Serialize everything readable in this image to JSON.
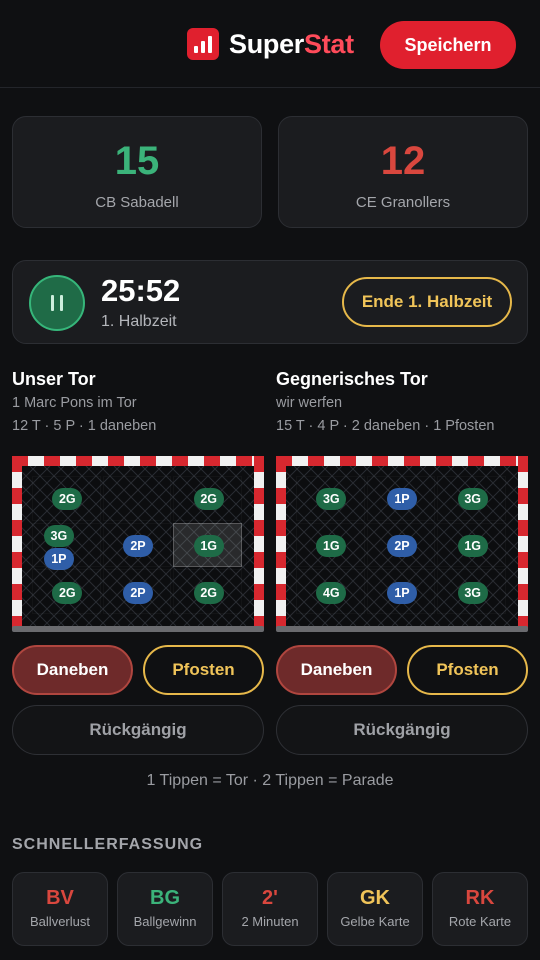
{
  "header": {
    "brand_a": "Super",
    "brand_b": "Stat",
    "save_label": "Speichern"
  },
  "colors": {
    "accent_red": "#e0202e",
    "home_score": "#3bb37a",
    "away_score": "#d9473e",
    "gold": "#f0c459",
    "save_green": "#1e6b47",
    "post_blue": "#2f5ea8"
  },
  "scores": {
    "home": {
      "value": "15",
      "team": "CB Sabadell"
    },
    "away": {
      "value": "12",
      "team": "CE Granollers"
    }
  },
  "timer": {
    "time": "25:52",
    "half": "1. Halbzeit",
    "end_label": "Ende 1. Halbzeit",
    "pause_icon": "pause-icon"
  },
  "our_goal": {
    "title": "Unser Tor",
    "keeper": "1 Marc Pons im Tor",
    "stats": "12 T · 5 P · 1 daneben",
    "cells": [
      {
        "zone": 1,
        "labels": [
          "2G"
        ]
      },
      {
        "zone": 2,
        "labels": []
      },
      {
        "zone": 3,
        "labels": [
          "2G"
        ]
      },
      {
        "zone": 4,
        "labels": [
          "3G",
          "1P"
        ]
      },
      {
        "zone": 5,
        "labels": [
          "2P"
        ]
      },
      {
        "zone": 6,
        "labels": [
          "1G"
        ],
        "selected": true
      },
      {
        "zone": 7,
        "labels": [
          "2G"
        ]
      },
      {
        "zone": 8,
        "labels": [
          "2P"
        ]
      },
      {
        "zone": 9,
        "labels": [
          "2G"
        ]
      }
    ],
    "miss_label": "Daneben",
    "post_label": "Pfosten",
    "undo_label": "Rückgängig"
  },
  "their_goal": {
    "title": "Gegnerisches Tor",
    "shooter": "wir werfen",
    "stats": "15 T · 4 P · 2 daneben · 1 Pfosten",
    "cells": [
      {
        "zone": 1,
        "labels": [
          "3G"
        ]
      },
      {
        "zone": 2,
        "labels": [
          "1P"
        ]
      },
      {
        "zone": 3,
        "labels": [
          "3G"
        ]
      },
      {
        "zone": 4,
        "labels": [
          "1G"
        ]
      },
      {
        "zone": 5,
        "labels": [
          "2P"
        ]
      },
      {
        "zone": 6,
        "labels": [
          "1G"
        ]
      },
      {
        "zone": 7,
        "labels": [
          "4G"
        ]
      },
      {
        "zone": 8,
        "labels": [
          "1P"
        ]
      },
      {
        "zone": 9,
        "labels": [
          "3G"
        ]
      }
    ],
    "miss_label": "Daneben",
    "post_label": "Pfosten",
    "undo_label": "Rückgängig"
  },
  "hint": "1 Tippen = Tor · 2 Tippen = Parade",
  "quick": {
    "title": "SCHNELLERFASSUNG",
    "items": [
      {
        "code": "BV",
        "label": "Ballverlust",
        "color": "#d9473e"
      },
      {
        "code": "BG",
        "label": "Ballgewinn",
        "color": "#3bb37a"
      },
      {
        "code": "2'",
        "label": "2 Minuten",
        "color": "#d9473e"
      },
      {
        "code": "GK",
        "label": "Gelbe Karte",
        "color": "#f0c459"
      },
      {
        "code": "RK",
        "label": "Rote Karte",
        "color": "#d9473e"
      }
    ]
  }
}
